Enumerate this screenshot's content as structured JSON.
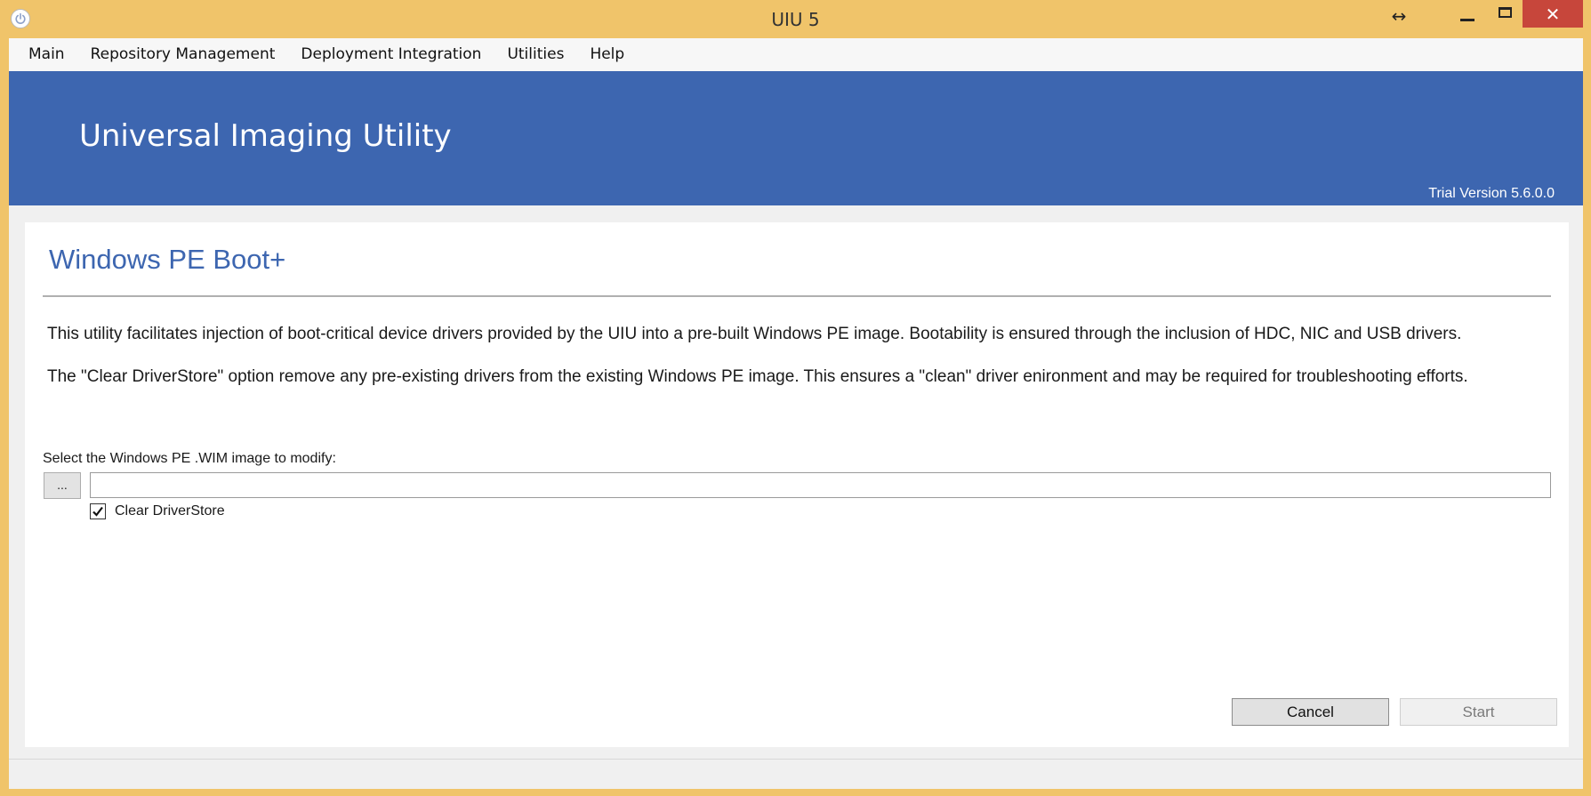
{
  "window": {
    "title": "UIU 5",
    "resize_glyph": "↔",
    "close_glyph": "✕",
    "icons": [
      "power-icon",
      "resize-icon",
      "minimize-icon",
      "maximize-icon",
      "close-icon"
    ]
  },
  "menu": {
    "items": [
      "Main",
      "Repository Management",
      "Deployment Integration",
      "Utilities",
      "Help"
    ]
  },
  "banner": {
    "title": "Universal Imaging Utility",
    "version": "Trial Version 5.6.0.0"
  },
  "page": {
    "title": "Windows PE Boot+",
    "description1": "This utility facilitates injection of boot-critical device drivers provided by the UIU into a pre-built Windows PE image. Bootability is ensured through the inclusion of HDC, NIC and USB drivers.",
    "description2": "The \"Clear DriverStore\" option remove any pre-existing drivers from the existing Windows PE image. This ensures a \"clean\" driver enironment and may be required for troubleshooting efforts.",
    "select_label": "Select the Windows PE .WIM image to modify:",
    "browse_label": "...",
    "path_value": "",
    "clear_driverstore_label": "Clear DriverStore",
    "clear_driverstore_checked": true,
    "cancel_label": "Cancel",
    "start_label": "Start"
  },
  "colors": {
    "titlebar": "#f0c46a",
    "banner": "#3d66b0",
    "close_button": "#c7463b",
    "title_text": "#3d66b0"
  }
}
